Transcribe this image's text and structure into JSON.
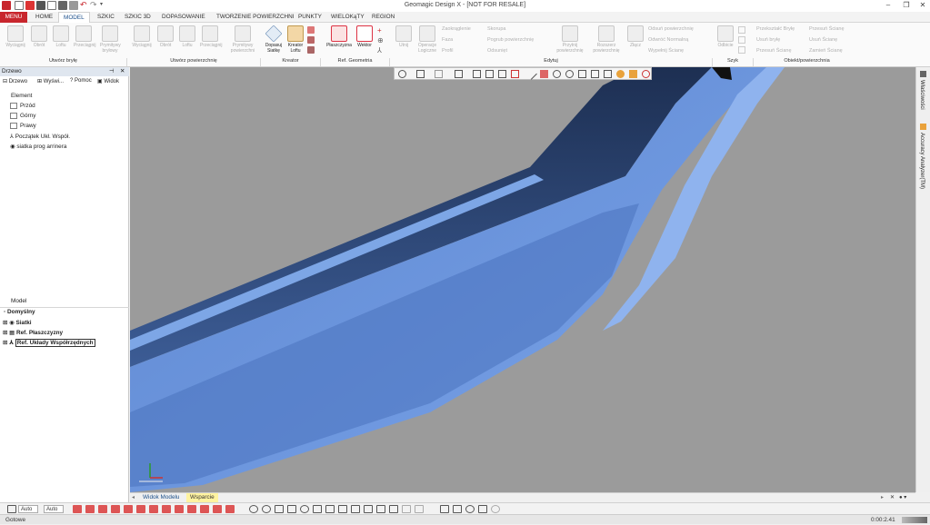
{
  "window": {
    "title": "Geomagic Design X - [NOT FOR RESALE]"
  },
  "ribbon_tabs": [
    {
      "label": "MENU",
      "id": "menu"
    },
    {
      "label": "HOME",
      "id": "home"
    },
    {
      "label": "MODEL",
      "id": "model",
      "active": true
    },
    {
      "label": "SZKIC",
      "id": "szkic"
    },
    {
      "label": "SZKIC 3D",
      "id": "szkic3d"
    },
    {
      "label": "DOPASOWANIE",
      "id": "dopasowanie"
    },
    {
      "label": "TWORZENIE POWIERZCHNI",
      "id": "tworzenie"
    },
    {
      "label": "PUNKTY",
      "id": "punkty"
    },
    {
      "label": "WIELOKąTY",
      "id": "wielokaty"
    },
    {
      "label": "REGION",
      "id": "region"
    }
  ],
  "ribbon": {
    "tworz_bryle": [
      "Wyciągnij",
      "Obrót",
      "Loftu",
      "Przeciągnij",
      "Prymitywy bryłowy"
    ],
    "tworz_powierzchnie": [
      "Wyciągnij",
      "Obrót",
      "Loftu",
      "Przeciągnij",
      "Prymitywy powierzchni"
    ],
    "kreator": [
      "Dopasuj Siatkę",
      "Kreator Loftu"
    ],
    "ref_geometria": [
      "Płaszczyzna",
      "Wektor"
    ],
    "edytuj_big": [
      "Utnij",
      "Operacje Logiczne",
      "Przytnij powierzchnię",
      "Rozszerz powierzchnię",
      "Złącz"
    ],
    "edytuj_small1": [
      "Zaokrąglenie",
      "Faza",
      "Profil"
    ],
    "edytuj_small2": [
      "Skorupa",
      "Pogrub powierzchnię",
      "Odsunięt"
    ],
    "edytuj_small3": [
      "Odsuń powierzchnię",
      "Odwróć Normalną",
      "Wypełnij Ścianę"
    ],
    "szyk": [
      "Odbicie"
    ],
    "obiekt_small1": [
      "Przekształć Bryłę",
      "Usuń bryłę",
      "Przesuń Ścianę"
    ],
    "obiekt_small2": [
      "Przesuń Ścianę",
      "Usuń Ścianę",
      "Zamień Ścianę"
    ],
    "groups": [
      "Utwórz bryłę",
      "Utwórz powierzchnię",
      "Kreator",
      "Ref. Geometria",
      "Edytuj",
      "Szyk",
      "Obiekt/powierzchnia"
    ]
  },
  "left_panel": {
    "title": "Drzewo",
    "tabs": [
      "Drzewo",
      "Wyświ...",
      "Pomoc",
      "Widok"
    ],
    "element_header": "Element",
    "elements": [
      "Przód",
      "Górny",
      "Prawy",
      "Początek Ukł. Współ.",
      "siatka prog arrinera"
    ],
    "model_header": "Model",
    "model_items": [
      "Domyślny",
      "Siatki",
      "Ref. Płaszczyzny",
      "Ref. Układy Współrzędnych"
    ]
  },
  "right_strip": [
    "Właściwości",
    "Accuracy Analyzer(TM)"
  ],
  "view_tabs": [
    "Widok Modelu",
    "Wsparcie"
  ],
  "bottom": {
    "auto1": "Auto",
    "auto2": "Auto"
  },
  "status": {
    "left": "Gotowe",
    "time": "0:00:2.41"
  },
  "colors": {
    "menu": "#c8262d",
    "mesh": "#6f95d6",
    "mesh_dark": "#27426e",
    "viewport": "#9b9b9b",
    "accent": "#1a4e8a"
  }
}
